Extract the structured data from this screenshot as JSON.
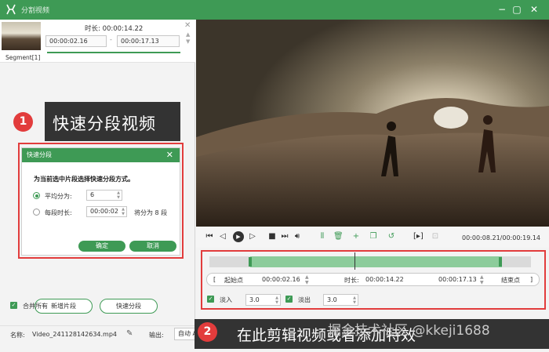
{
  "window": {
    "title": "分割视频",
    "minimize_icon": "minimize-icon",
    "maximize_icon": "maximize-icon",
    "close_icon": "close-icon",
    "accent": "#3e9a55"
  },
  "segment": {
    "label": "Segment[1]",
    "duration_label": "时长:",
    "duration_value": "00:00:14.22",
    "start": "00:00:02.16",
    "separator": "-",
    "end": "00:00:17.13"
  },
  "callouts": {
    "one_number": "1",
    "one_text": "快速分段视频",
    "two_number": "2",
    "two_text": "在此剪辑视频或者添加特效",
    "watermark": "掘金技术社区 @kkeji1688"
  },
  "quick_split": {
    "title": "快速分段",
    "instruction": "为当前选中片段选择快速分段方式。",
    "option_equal_label": "平均分为:",
    "option_equal_value": "6",
    "option_each_label": "每段时长:",
    "option_each_value": "00:00:02",
    "option_each_suffix": "将分为 8 段",
    "confirm": "确定",
    "cancel": "取消",
    "selected_option": "equal"
  },
  "left_actions": {
    "new_segment": "新增片段",
    "quick_split": "快速分段",
    "merge_all": "合并所有",
    "merge_all_checked": true
  },
  "player": {
    "time_current": "00:00:08.21",
    "time_total": "00:00:19.14",
    "time_separator": "/"
  },
  "editor": {
    "start_point_label": "起始点",
    "start_value": "00:00:02.16",
    "duration_label": "时长:",
    "duration_value": "00:00:14.22",
    "end_value": "00:00:17.13",
    "end_point_label": "结束点",
    "fade_in_label": "淡入",
    "fade_in_value": "3.0",
    "fade_out_label": "淡出",
    "fade_out_value": "3.0",
    "fade_in_checked": true,
    "fade_out_checked": true
  },
  "bottom": {
    "name_label": "名称:",
    "name_value": "Video_241128142634.mp4",
    "output_label": "输出:",
    "output_value": "自动 A"
  }
}
